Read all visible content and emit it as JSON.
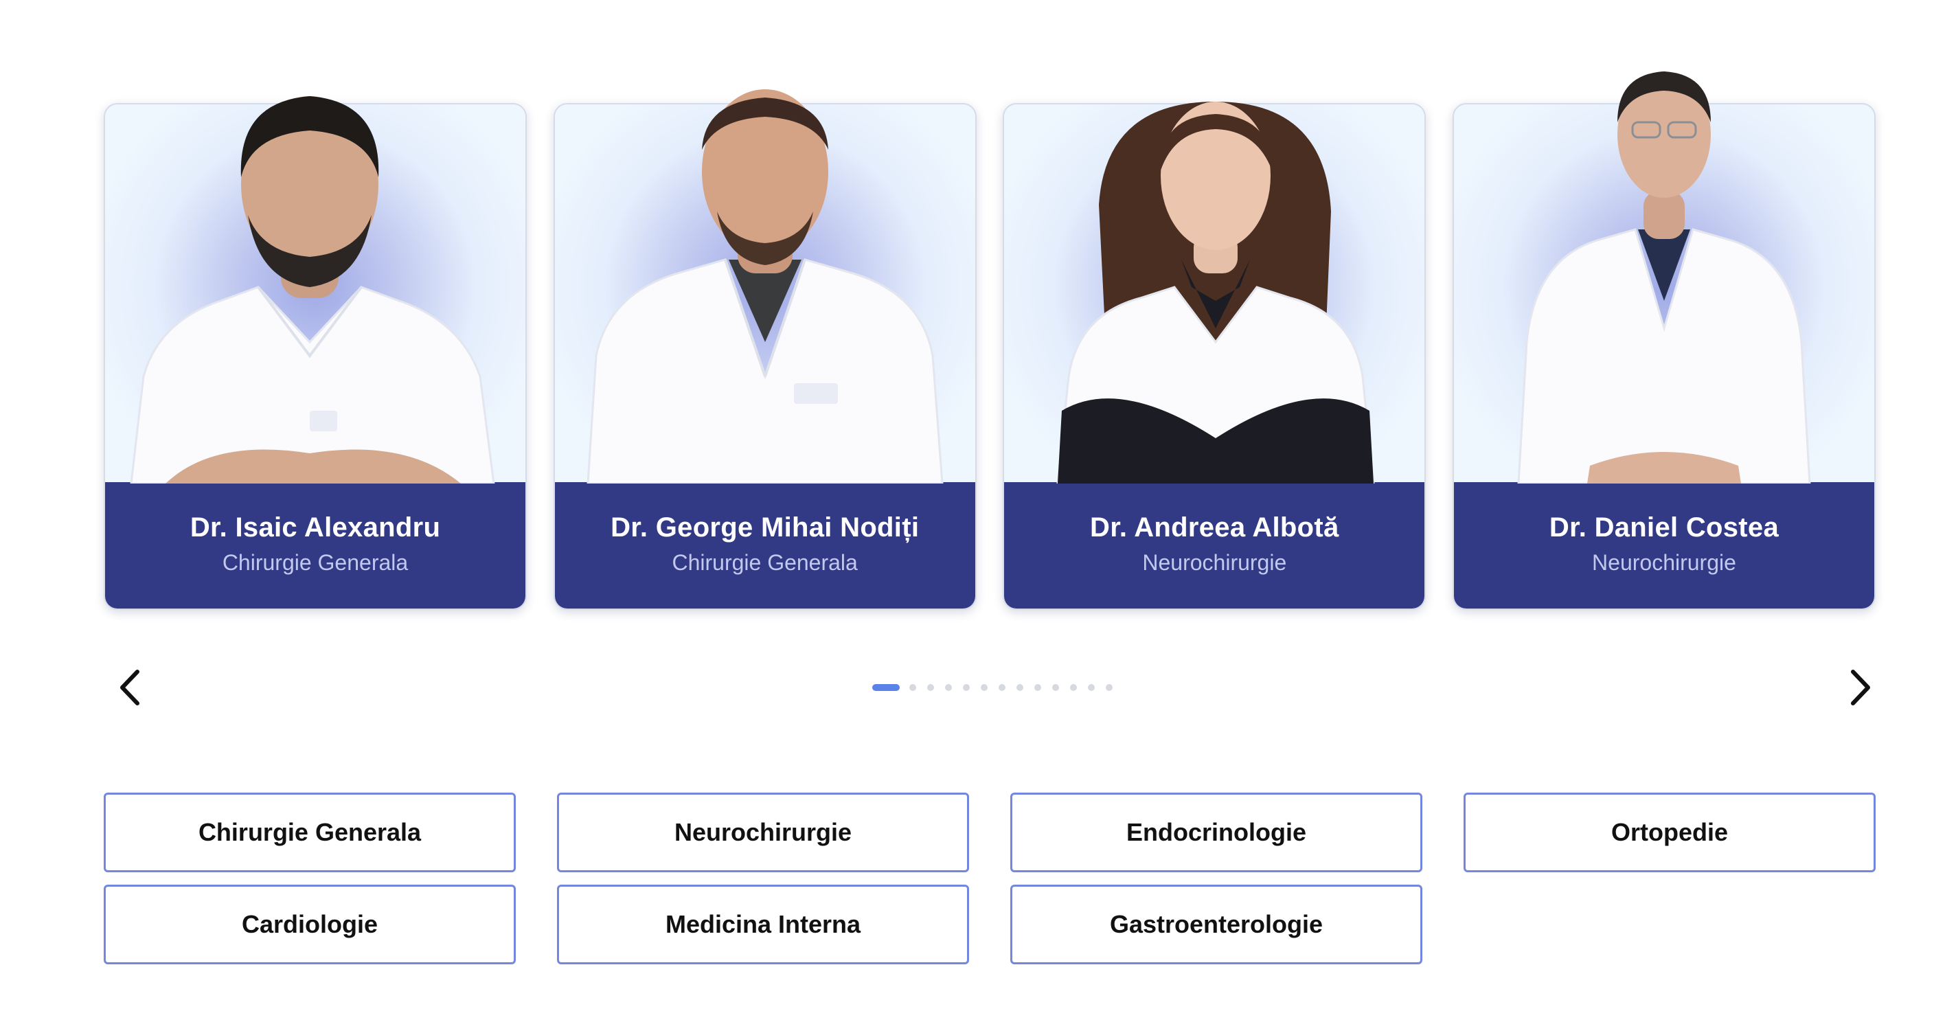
{
  "doctors": [
    {
      "name": "Dr. Isaic Alexandru",
      "specialty": "Chirurgie Generala"
    },
    {
      "name": "Dr. George Mihai Nodiți",
      "specialty": "Chirurgie Generala"
    },
    {
      "name": "Dr. Andreea Albotă",
      "specialty": "Neurochirurgie"
    },
    {
      "name": "Dr. Daniel Costea",
      "specialty": "Neurochirurgie"
    }
  ],
  "carousel": {
    "prev_icon": "chevron-left-icon",
    "next_icon": "chevron-right-icon",
    "page_count": 13,
    "active_page": 1,
    "active_color": "#5b82e8",
    "inactive_color": "#d6d9e0"
  },
  "specialties": [
    "Chirurgie Generala",
    "Neurochirurgie",
    "Endocrinologie",
    "Ortopedie",
    "Cardiologie",
    "Medicina Interna",
    "Gastroenterologie"
  ],
  "colors": {
    "card_footer": "#333a85",
    "button_border": "#7487de"
  }
}
